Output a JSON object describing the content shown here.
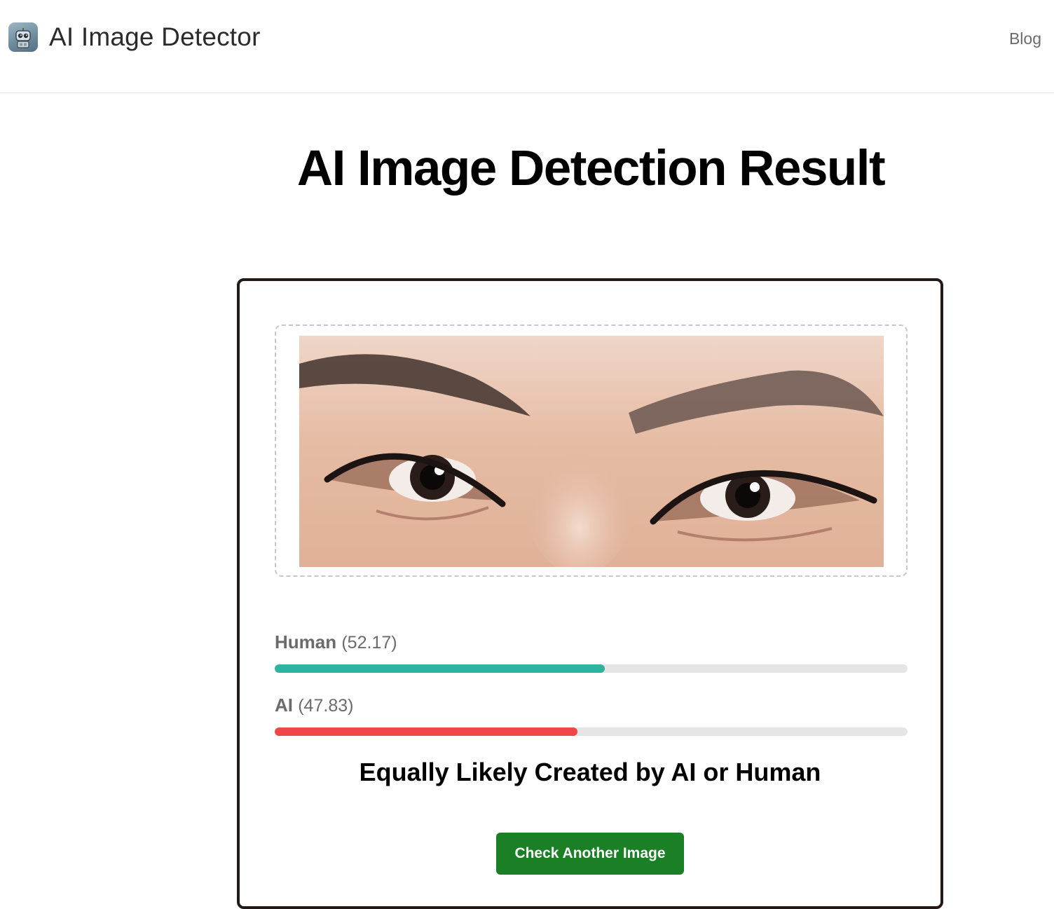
{
  "header": {
    "brand_name": "AI Image Detector",
    "logo_icon": "robot-icon",
    "nav": [
      {
        "label": "Blog"
      }
    ]
  },
  "page": {
    "title": "AI Image Detection Result"
  },
  "result": {
    "image_alt": "Close-up of a pair of human eyes and eyebrows",
    "scores": [
      {
        "label": "Human",
        "score_text": "(52.17)",
        "value": 52.17,
        "color": "#2bb5a0"
      },
      {
        "label": "AI",
        "score_text": "(47.83)",
        "value": 47.83,
        "color": "#ef4747"
      }
    ],
    "verdict": "Equally Likely Created by AI or Human",
    "button_label": "Check Another Image"
  },
  "colors": {
    "button_bg": "#1a7f25",
    "card_border": "#231a17",
    "track_bg": "#e5e5e5"
  }
}
